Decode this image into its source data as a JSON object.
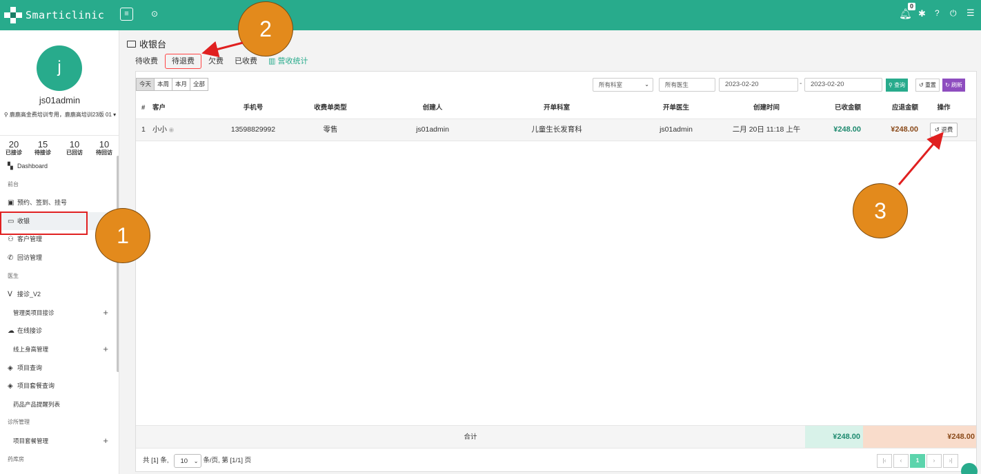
{
  "topbar": {
    "brand": "Smarticlinic",
    "menu_icon": "list-icon",
    "notification_count": "0"
  },
  "sidebar": {
    "avatar_letter": "j",
    "username": "js01admin",
    "org": "鹿鹿高金费培训专用，鹿鹿高培训23版 01",
    "stats": [
      {
        "num": "20",
        "label": "已接诊"
      },
      {
        "num": "15",
        "label": "待接诊"
      },
      {
        "num": "10",
        "label": "已回访"
      },
      {
        "num": "10",
        "label": "待回访"
      }
    ],
    "items": [
      {
        "label": "Dashboard"
      },
      {
        "label": "前台"
      },
      {
        "label": "预约、签到、挂号"
      },
      {
        "label": "收银"
      },
      {
        "label": "客户管理"
      },
      {
        "label": "回访管理"
      },
      {
        "label": "医生"
      },
      {
        "label": "接诊_V2"
      },
      {
        "label": "管理类项目接诊"
      },
      {
        "label": "在线接诊"
      },
      {
        "label": "线上身高管理"
      },
      {
        "label": "项目查询"
      },
      {
        "label": "项目套餐查询"
      },
      {
        "label": "药品产品提醒列表"
      },
      {
        "label": "诊所管理"
      },
      {
        "label": "项目套餐管理"
      },
      {
        "label": "药库房"
      }
    ]
  },
  "main": {
    "title": "收银台",
    "tabs": [
      "待收费",
      "待退费",
      "欠费",
      "已收费",
      "营收统计"
    ],
    "filters": {
      "ranges": [
        "今天",
        "本周",
        "本月",
        "全部"
      ],
      "department": "所有科室",
      "doctor_placeholder": "所有医生",
      "date_from": "2023-02-20",
      "date_to": "2023-02-20",
      "search_label": "查询",
      "reset_label": "重置",
      "refresh_label": "刷新"
    },
    "columns": [
      "#",
      "客户",
      "手机号",
      "收费单类型",
      "创建人",
      "开单科室",
      "开单医生",
      "创建时间",
      "已收金额",
      "应退金额",
      "操作"
    ],
    "rows": [
      {
        "index": "1",
        "customer": "小小",
        "phone": "13598829992",
        "type": "零售",
        "creator": "js01admin",
        "department": "儿童生长发育科",
        "doctor": "js01admin",
        "created": "二月 20日 11:18 上午",
        "received": "¥248.00",
        "refundable": "¥248.00",
        "action": "退费"
      }
    ],
    "footer": {
      "label": "合计",
      "received_total": "¥248.00",
      "refund_total": "¥248.00"
    },
    "pagination": {
      "total_text": "共 [1] 条,",
      "page_size": "10",
      "per_page_text": "条/页,",
      "page_text": "第 [1/1] 页",
      "first": "|‹",
      "prev": "‹",
      "current": "1",
      "next": "›",
      "last": "›|"
    }
  },
  "annotations": {
    "step1": "1",
    "step2": "2",
    "step3": "3",
    "color_callout": "#e38a1c",
    "color_arrow": "#e02020"
  }
}
